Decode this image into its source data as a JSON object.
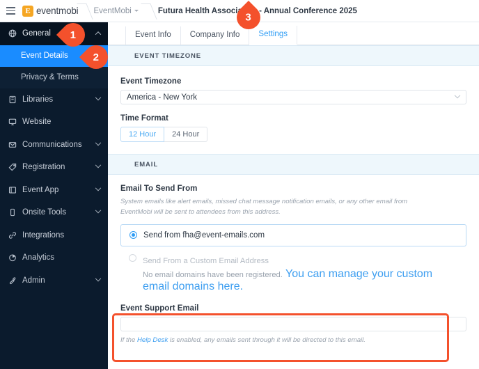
{
  "topbar": {
    "menu_icon": "hamburger-icon",
    "logo_mark": "E",
    "logo_text": "eventmobi",
    "breadcrumb_org": "EventMobi",
    "breadcrumb_event": "Futura Health Association - Annual Conference 2025"
  },
  "sidebar": {
    "items": [
      {
        "label": "General",
        "icon": "globe-icon",
        "expanded": true,
        "chevron": "chevron-up-icon"
      },
      {
        "label": "Libraries",
        "icon": "book-icon",
        "chevron": "chevron-down-icon"
      },
      {
        "label": "Website",
        "icon": "monitor-icon",
        "chevron": ""
      },
      {
        "label": "Communications",
        "icon": "envelope-icon",
        "chevron": "chevron-down-icon"
      },
      {
        "label": "Registration",
        "icon": "tag-icon",
        "chevron": "chevron-down-icon"
      },
      {
        "label": "Event App",
        "icon": "app-window-icon",
        "chevron": "chevron-down-icon"
      },
      {
        "label": "Onsite Tools",
        "icon": "mobile-icon",
        "chevron": "chevron-down-icon"
      },
      {
        "label": "Integrations",
        "icon": "link-icon",
        "chevron": ""
      },
      {
        "label": "Analytics",
        "icon": "pie-chart-icon",
        "chevron": ""
      },
      {
        "label": "Admin",
        "icon": "wrench-icon",
        "chevron": "chevron-down-icon"
      }
    ],
    "subitems": [
      {
        "label": "Event Details",
        "selected": true
      },
      {
        "label": "Privacy & Terms",
        "selected": false
      }
    ]
  },
  "tabs": [
    {
      "label": "Event Info",
      "active": false
    },
    {
      "label": "Company Info",
      "active": false
    },
    {
      "label": "Settings",
      "active": true
    }
  ],
  "timezone_section": {
    "header": "EVENT TIMEZONE",
    "timezone_label": "Event Timezone",
    "timezone_value": "America - New York",
    "time_format_label": "Time Format",
    "time_format_options": [
      {
        "label": "12 Hour",
        "active": true
      },
      {
        "label": "24 Hour",
        "active": false
      }
    ]
  },
  "email_section": {
    "header": "EMAIL",
    "send_from_label": "Email To Send From",
    "send_from_helper": "System emails like alert emails, missed chat message notification emails, or any other email from EventMobi will be sent to attendees from this address.",
    "option_default": "Send from fha@event-emails.com",
    "option_custom": "Send From a Custom Email Address",
    "option_custom_note": "No email domains have been registered.",
    "option_custom_link": "You can manage your custom email domains here.",
    "support_label": "Event Support Email",
    "support_value": "",
    "support_placeholder": "",
    "support_helper_pre": "If the ",
    "support_helper_link": "Help Desk",
    "support_helper_post": " is enabled, any emails sent through it will be directed to this email."
  },
  "markers": [
    {
      "number": "1"
    },
    {
      "number": "2"
    },
    {
      "number": "3"
    }
  ],
  "colors": {
    "accent_blue": "#2d9cf5",
    "sidebar_bg": "#0b1b2d",
    "selected_blue": "#1a8cff",
    "marker_orange": "#f4512c",
    "section_bg": "#eef7fc"
  }
}
